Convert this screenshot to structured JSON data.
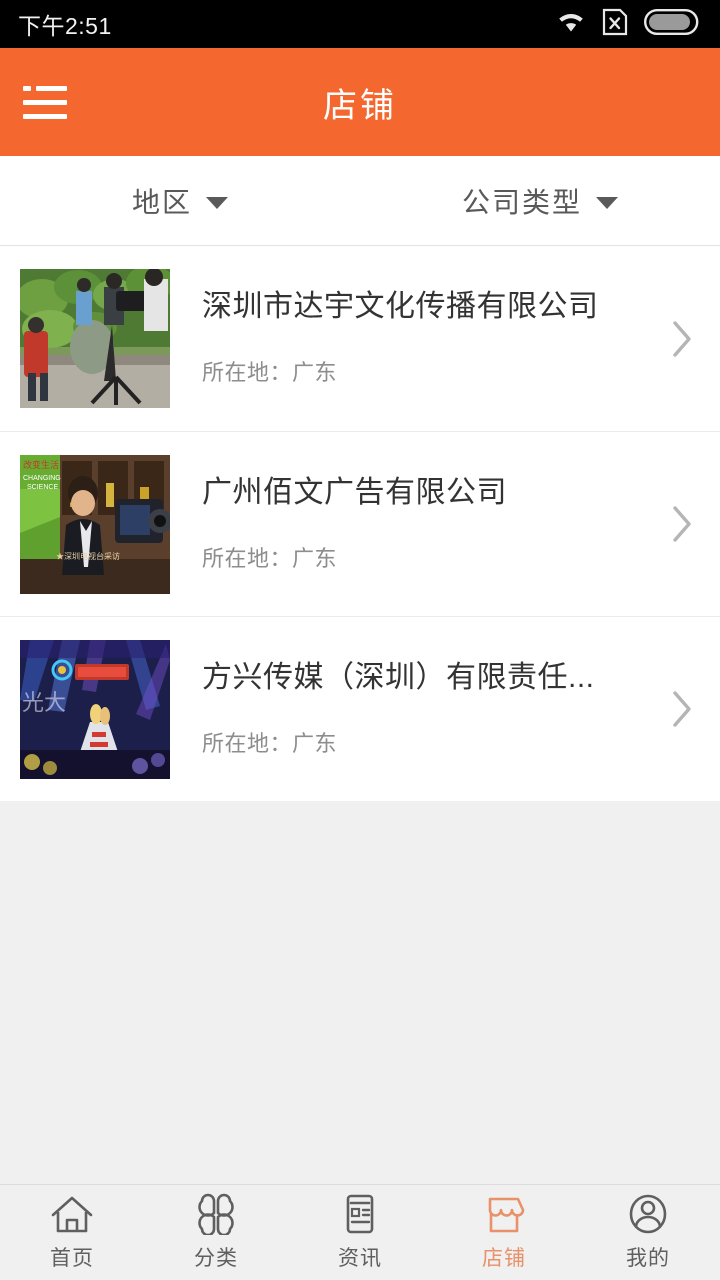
{
  "statusbar": {
    "time": "下午2:51",
    "icons": [
      "wifi-icon",
      "sim-card-x-icon",
      "battery-icon"
    ]
  },
  "header": {
    "title": "店铺",
    "menu_icon": "hamburger-menu-icon",
    "background_color": "#f4682f"
  },
  "filters": [
    {
      "label": "地区",
      "icon": "chevron-down-icon"
    },
    {
      "label": "公司类型",
      "icon": "chevron-down-icon"
    }
  ],
  "list": {
    "items": [
      {
        "title": "深圳市达宇文化传播有限公司",
        "subtitle": "所在地：广东",
        "thumbnail": "outdoor-film-crew-photo",
        "arrow_icon": "chevron-right-icon"
      },
      {
        "title": "广州佰文广告有限公司",
        "subtitle": "所在地：广东",
        "thumbnail": "interview-studio-photo",
        "arrow_icon": "chevron-right-icon"
      },
      {
        "title": "方兴传媒（深圳）有限责任...",
        "subtitle": "所在地：广东",
        "thumbnail": "concert-stage-photo",
        "arrow_icon": "chevron-right-icon"
      }
    ]
  },
  "tabbar": {
    "active_color": "#e8916a",
    "inactive_color": "#5f5f5f",
    "tabs": [
      {
        "label": "首页",
        "icon": "home-icon",
        "active": false
      },
      {
        "label": "分类",
        "icon": "clover-grid-icon",
        "active": false
      },
      {
        "label": "资讯",
        "icon": "news-document-icon",
        "active": false
      },
      {
        "label": "店铺",
        "icon": "storefront-icon",
        "active": true
      },
      {
        "label": "我的",
        "icon": "user-profile-icon",
        "active": false
      }
    ]
  }
}
